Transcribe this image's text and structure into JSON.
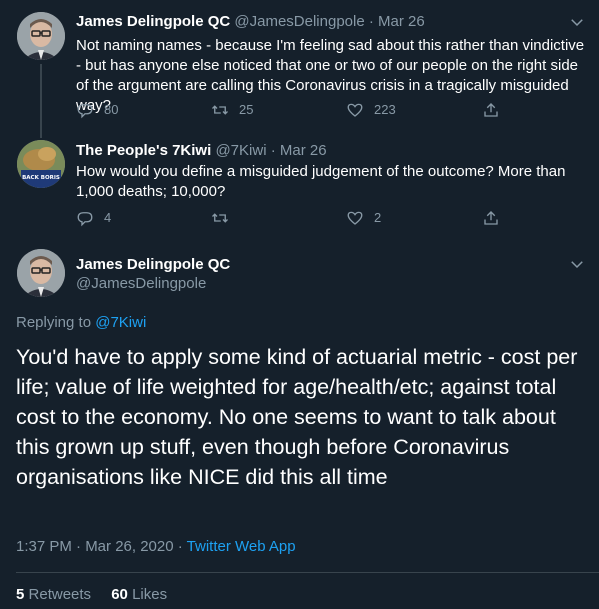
{
  "tweet1": {
    "name": "James Delingpole QC",
    "handle": "@JamesDelingpole",
    "separator": "·",
    "date": "Mar 26",
    "text": "Not naming names - because I'm feeling sad about this rather than vindictive - but has anyone else noticed that one or two of our people on the right side of the argument are calling this Coronavirus crisis in a tragically misguided way?",
    "replies": "80",
    "retweets": "25",
    "likes": "223"
  },
  "tweet2": {
    "name": "The People's 7Kiwi",
    "handle": "@7Kiwi",
    "separator": "·",
    "date": "Mar 26",
    "avatar_text": "BACK BORIS",
    "text": "How would you define a misguided judgement of the outcome? More than 1,000 deaths; 10,000?",
    "replies": "4",
    "retweets": "",
    "likes": "2"
  },
  "main": {
    "name": "James Delingpole QC",
    "handle": "@JamesDelingpole",
    "replying_prefix": "Replying to ",
    "replying_to": "@7Kiwi",
    "text": "You'd have to apply some kind of actuarial metric - cost per life; value of life weighted for age/health/etc; against total cost to the economy. No one seems to want to talk about this grown up stuff, even though before Coronavirus organisations like NICE did this all time",
    "time": "1:37 PM · Mar 26, 2020",
    "separator": " · ",
    "source": "Twitter Web App",
    "retweets_count": "5",
    "retweets_label": "Retweets",
    "likes_count": "60",
    "likes_label": "Likes"
  },
  "colors": {
    "background": "#15202b",
    "secondary_text": "#8899a6",
    "link": "#1da1f2",
    "divider": "#38444d"
  },
  "icons": [
    "chevron-down-icon",
    "reply-icon",
    "retweet-icon",
    "like-icon",
    "share-icon"
  ]
}
